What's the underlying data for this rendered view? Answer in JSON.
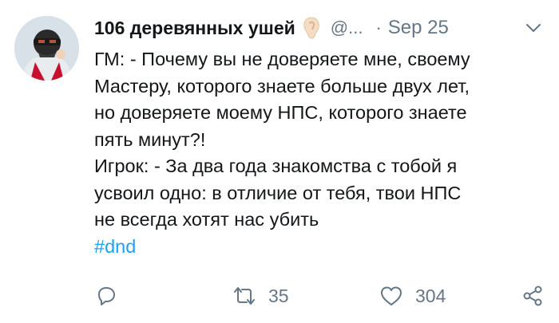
{
  "tweet": {
    "author_name": "106 деревянных ушей",
    "handle": "@...",
    "separator": "·",
    "time": "Sep 25",
    "text_lines": [
      "ГМ: - Почему вы не доверяете мне, своему",
      "Мастеру, которого знаете больше двух лет,",
      "но доверяете моему НПС, которого знаете",
      "пять минут?!",
      "Игрок: - За два года знакомства с тобой я",
      "усвоил одно: в отличие от тебя, твои НПС",
      "не всегда хотят нас убить"
    ],
    "hashtag": "#dnd"
  },
  "actions": {
    "reply_icon": "speech-bubble-icon",
    "retweet_icon": "retweet-icon",
    "retweet_count": "35",
    "like_icon": "heart-icon",
    "like_count": "304",
    "share_icon": "share-icon"
  },
  "colors": {
    "text": "#14171a",
    "secondary": "#657786",
    "link": "#1da1f2"
  }
}
